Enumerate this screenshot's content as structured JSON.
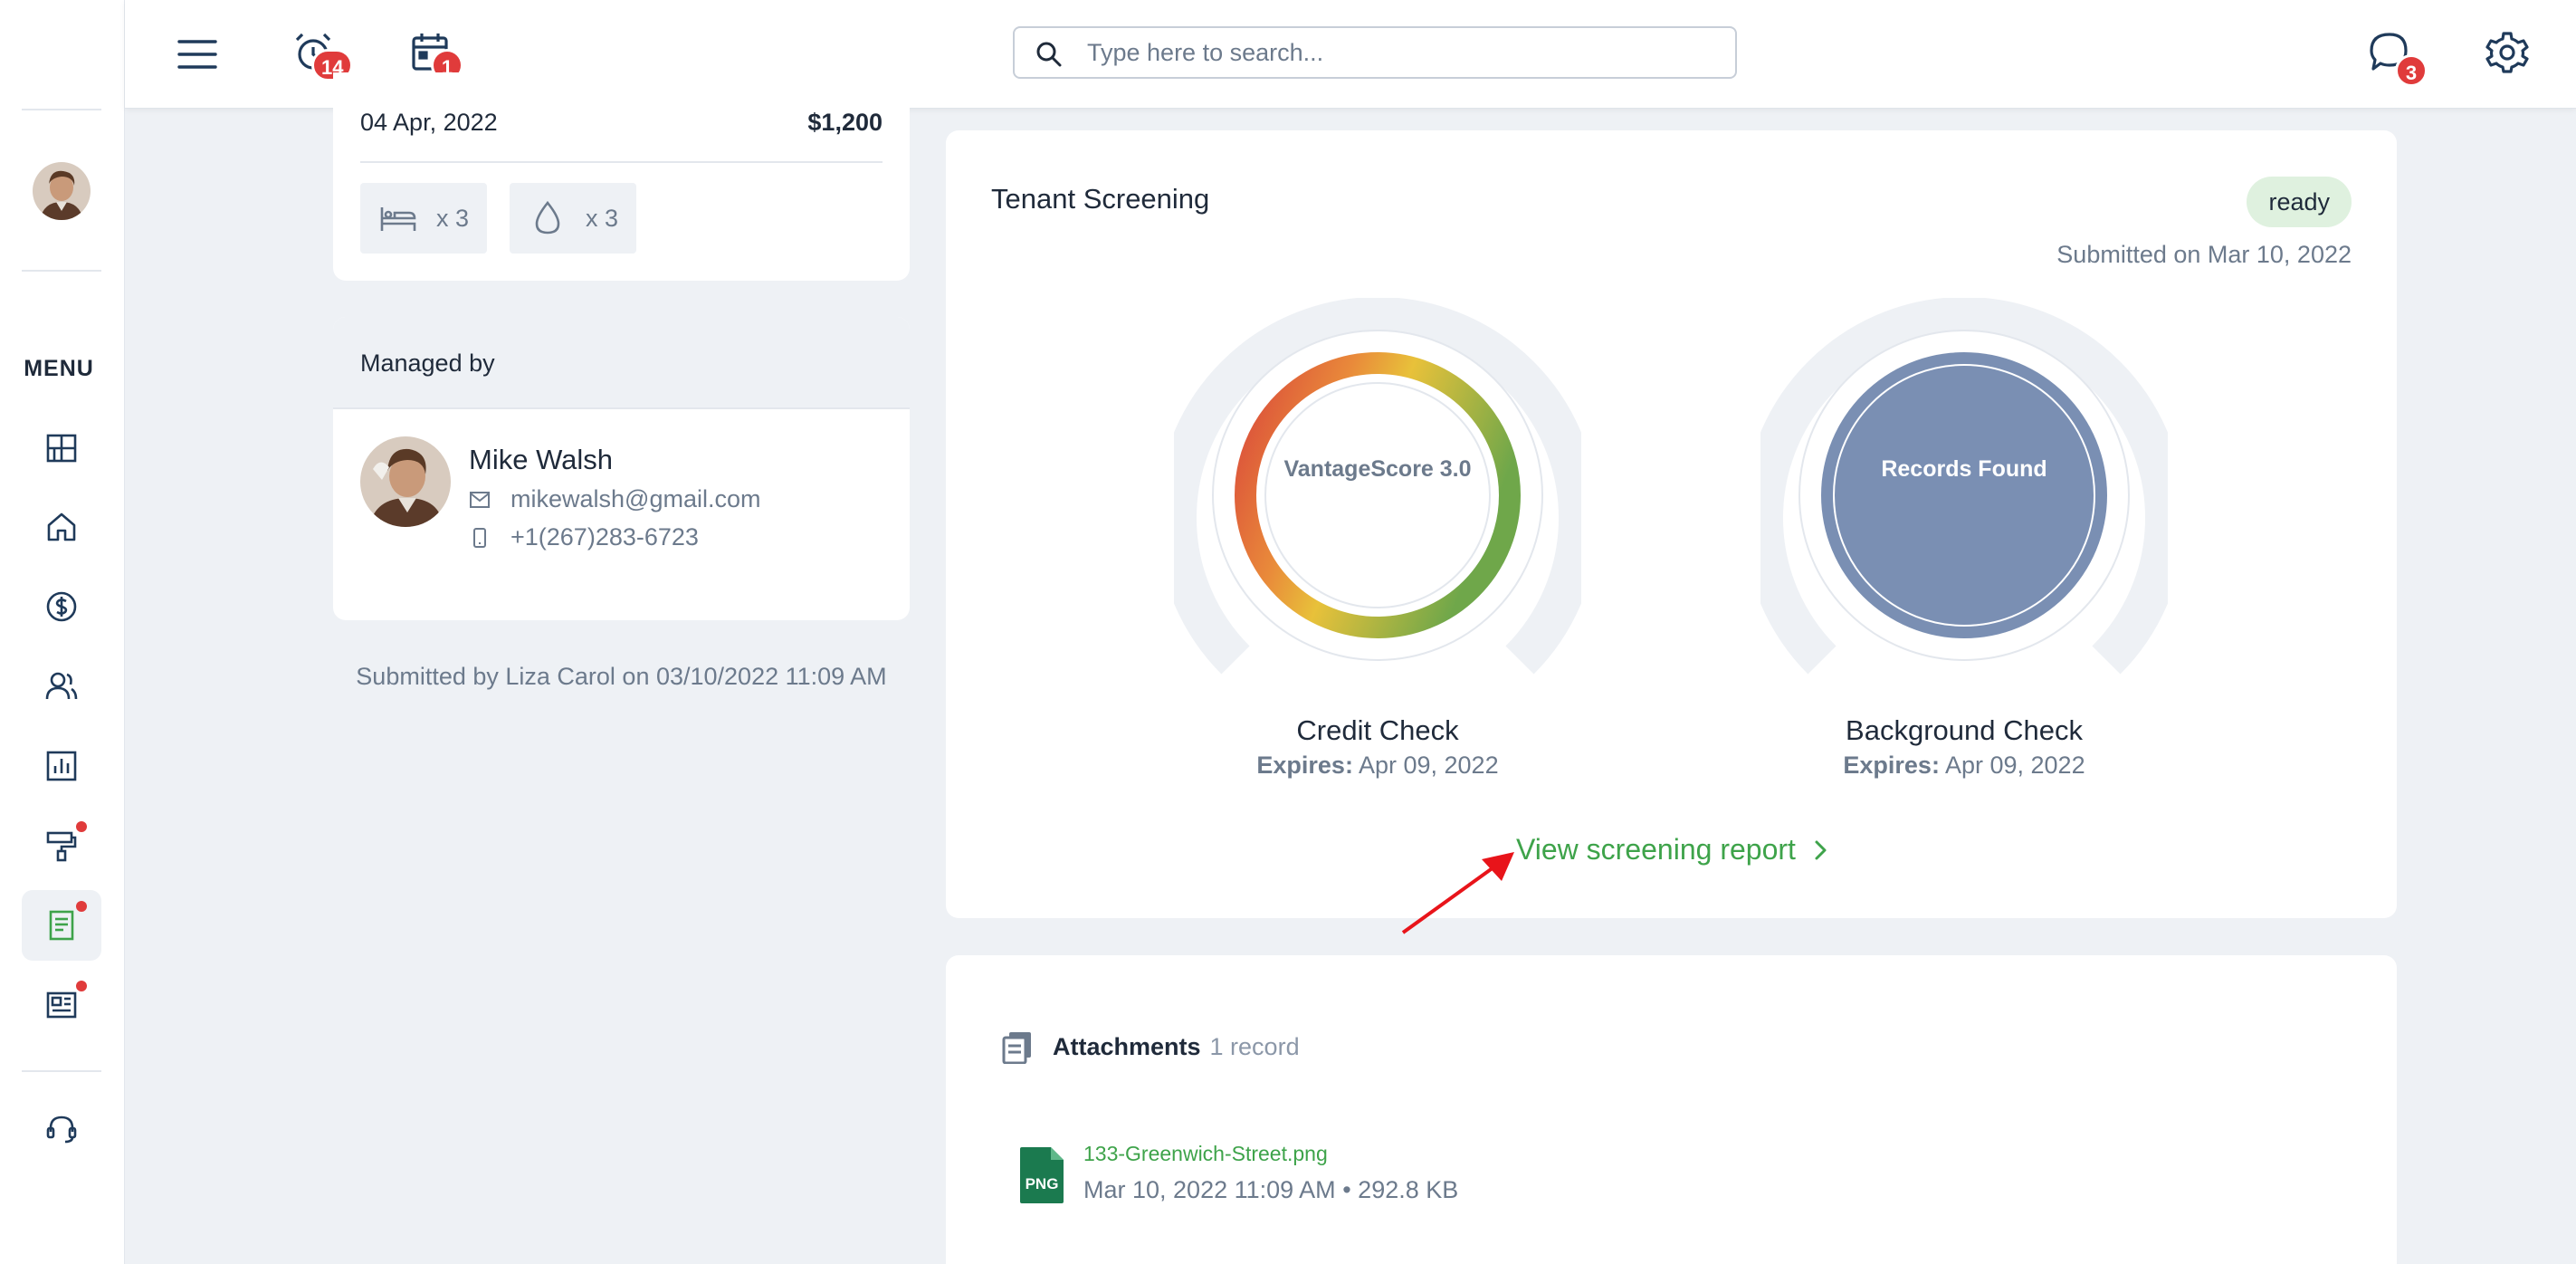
{
  "sidebar": {
    "menu_label": "MENU",
    "items": [
      {
        "name": "dashboard",
        "icon": "dashboard-grid-icon"
      },
      {
        "name": "properties",
        "icon": "home-icon"
      },
      {
        "name": "accounting",
        "icon": "dollar-circle-icon"
      },
      {
        "name": "people",
        "icon": "users-icon"
      },
      {
        "name": "reports",
        "icon": "bar-chart-icon"
      },
      {
        "name": "maintenance",
        "icon": "paint-roller-icon",
        "has_dot": true
      },
      {
        "name": "applications",
        "icon": "document-icon",
        "active": true,
        "has_dot": true
      },
      {
        "name": "listings",
        "icon": "newspaper-icon",
        "has_dot": true
      },
      {
        "name": "support",
        "icon": "headset-icon"
      }
    ]
  },
  "topbar": {
    "notifications_count": "14",
    "calendar_count": "1",
    "messages_count": "3",
    "search_placeholder": "Type here to search..."
  },
  "lease": {
    "date": "04 Apr, 2022",
    "amount": "$1,200",
    "bedrooms": "x 3",
    "bathrooms": "x 3"
  },
  "managed_by": {
    "heading": "Managed by",
    "name": "Mike Walsh",
    "email": "mikewalsh@gmail.com",
    "phone": "+1(267)283-6723"
  },
  "submitted_by": "Submitted by Liza Carol on 03/10/2022 11:09 AM",
  "screening": {
    "title": "Tenant Screening",
    "status": "ready",
    "submitted_on": "Submitted on Mar 10, 2022",
    "credit": {
      "center_label": "VantageScore 3.0",
      "title": "Credit Check",
      "expires_label": "Expires:",
      "expires_date": "Apr 09, 2022"
    },
    "background": {
      "center_label": "Records Found",
      "title": "Background Check",
      "expires_label": "Expires:",
      "expires_date": "Apr 09, 2022"
    },
    "report_link": "View screening report"
  },
  "attachments": {
    "title": "Attachments",
    "count": "1 record",
    "files": [
      {
        "name": "133-Greenwich-Street.png",
        "date": "Mar 10, 2022 11:09 AM",
        "size": "292.8 KB",
        "type": "PNG"
      }
    ]
  },
  "colors": {
    "accent_green": "#3ea34a",
    "badge_red": "#e03b3b",
    "records_blue": "#7a8fb3",
    "text_muted": "#6c7a8c"
  }
}
